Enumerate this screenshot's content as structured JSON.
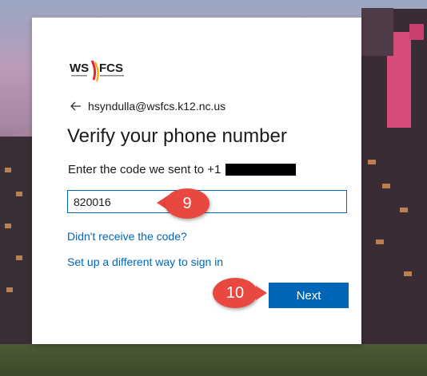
{
  "brand": {
    "logo_text": "WS FCS",
    "accent": "#0067b8",
    "callout_color": "#e8483f"
  },
  "account": {
    "email": "hsyndulla@wsfcs.k12.nc.us",
    "back_icon": "arrow-left-icon"
  },
  "verify": {
    "title": "Verify your phone number",
    "description": "Enter the code we sent to +1"
  },
  "code_input": {
    "value": "820016",
    "placeholder": ""
  },
  "links": {
    "didnt_receive": "Didn't receive the code?",
    "different_way": "Set up a different way to sign in"
  },
  "actions": {
    "next_label": "Next"
  },
  "callouts": {
    "step_input": "9",
    "step_next": "10"
  }
}
